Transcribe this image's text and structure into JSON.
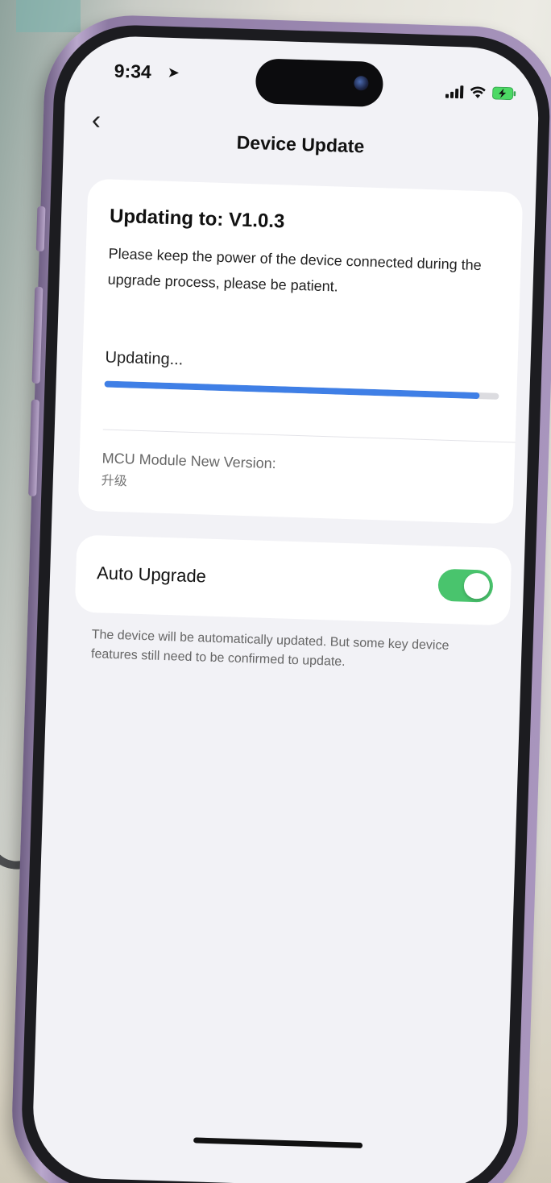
{
  "status_bar": {
    "time": "9:34",
    "location_icon": "location-arrow-icon",
    "signal_icon": "cellular-signal-icon",
    "wifi_icon": "wifi-icon",
    "battery_icon": "battery-charging-icon"
  },
  "nav": {
    "back_icon": "chevron-left-icon",
    "title": "Device Update"
  },
  "update_card": {
    "title": "Updating to: V1.0.3",
    "description": "Please keep the power of the device connected during the upgrade process, please be patient.",
    "progress_label": "Updating...",
    "progress_fraction": 0.95,
    "progress_color": "#3f7fe6",
    "mcu_label": "MCU Module New Version:",
    "mcu_value": "升级"
  },
  "auto_upgrade": {
    "label": "Auto Upgrade",
    "enabled": true,
    "toggle_color": "#49c46d",
    "note": "The device will be automatically updated. But some key device features still need to be confirmed to update."
  }
}
